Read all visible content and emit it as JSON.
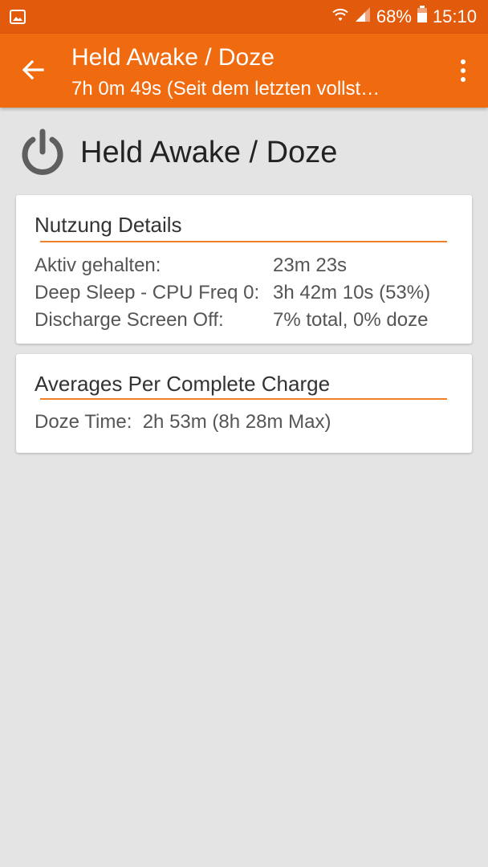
{
  "status_bar": {
    "battery_percent": "68%",
    "time": "15:10",
    "left_icon": "image-icon",
    "icons": [
      "wifi-icon",
      "signal-icon",
      "battery-icon"
    ]
  },
  "app_bar": {
    "title": "Held Awake / Doze",
    "subtitle": "7h 0m 49s (Seit dem letzten vollst…",
    "back_icon": "arrow-back-icon",
    "menu_icon": "overflow-menu-icon"
  },
  "header": {
    "title": "Held Awake / Doze",
    "icon": "power-icon"
  },
  "usage_card": {
    "title": "Nutzung Details",
    "rows": [
      {
        "label": "Aktiv gehalten:",
        "value": "23m 23s"
      },
      {
        "label": "Deep Sleep - CPU Freq 0:",
        "value": "3h 42m 10s (53%)"
      },
      {
        "label": "Discharge Screen Off:",
        "value": "7% total, 0% doze"
      }
    ]
  },
  "averages_card": {
    "title": "Averages Per Complete Charge",
    "doze_text": "Doze Time:  2h 53m (8h 28m Max)"
  },
  "colors": {
    "status_bar": "#e25a0b",
    "app_bar": "#f06a0f",
    "accent_rule": "#f07f2a",
    "background": "#e4e4e4"
  }
}
